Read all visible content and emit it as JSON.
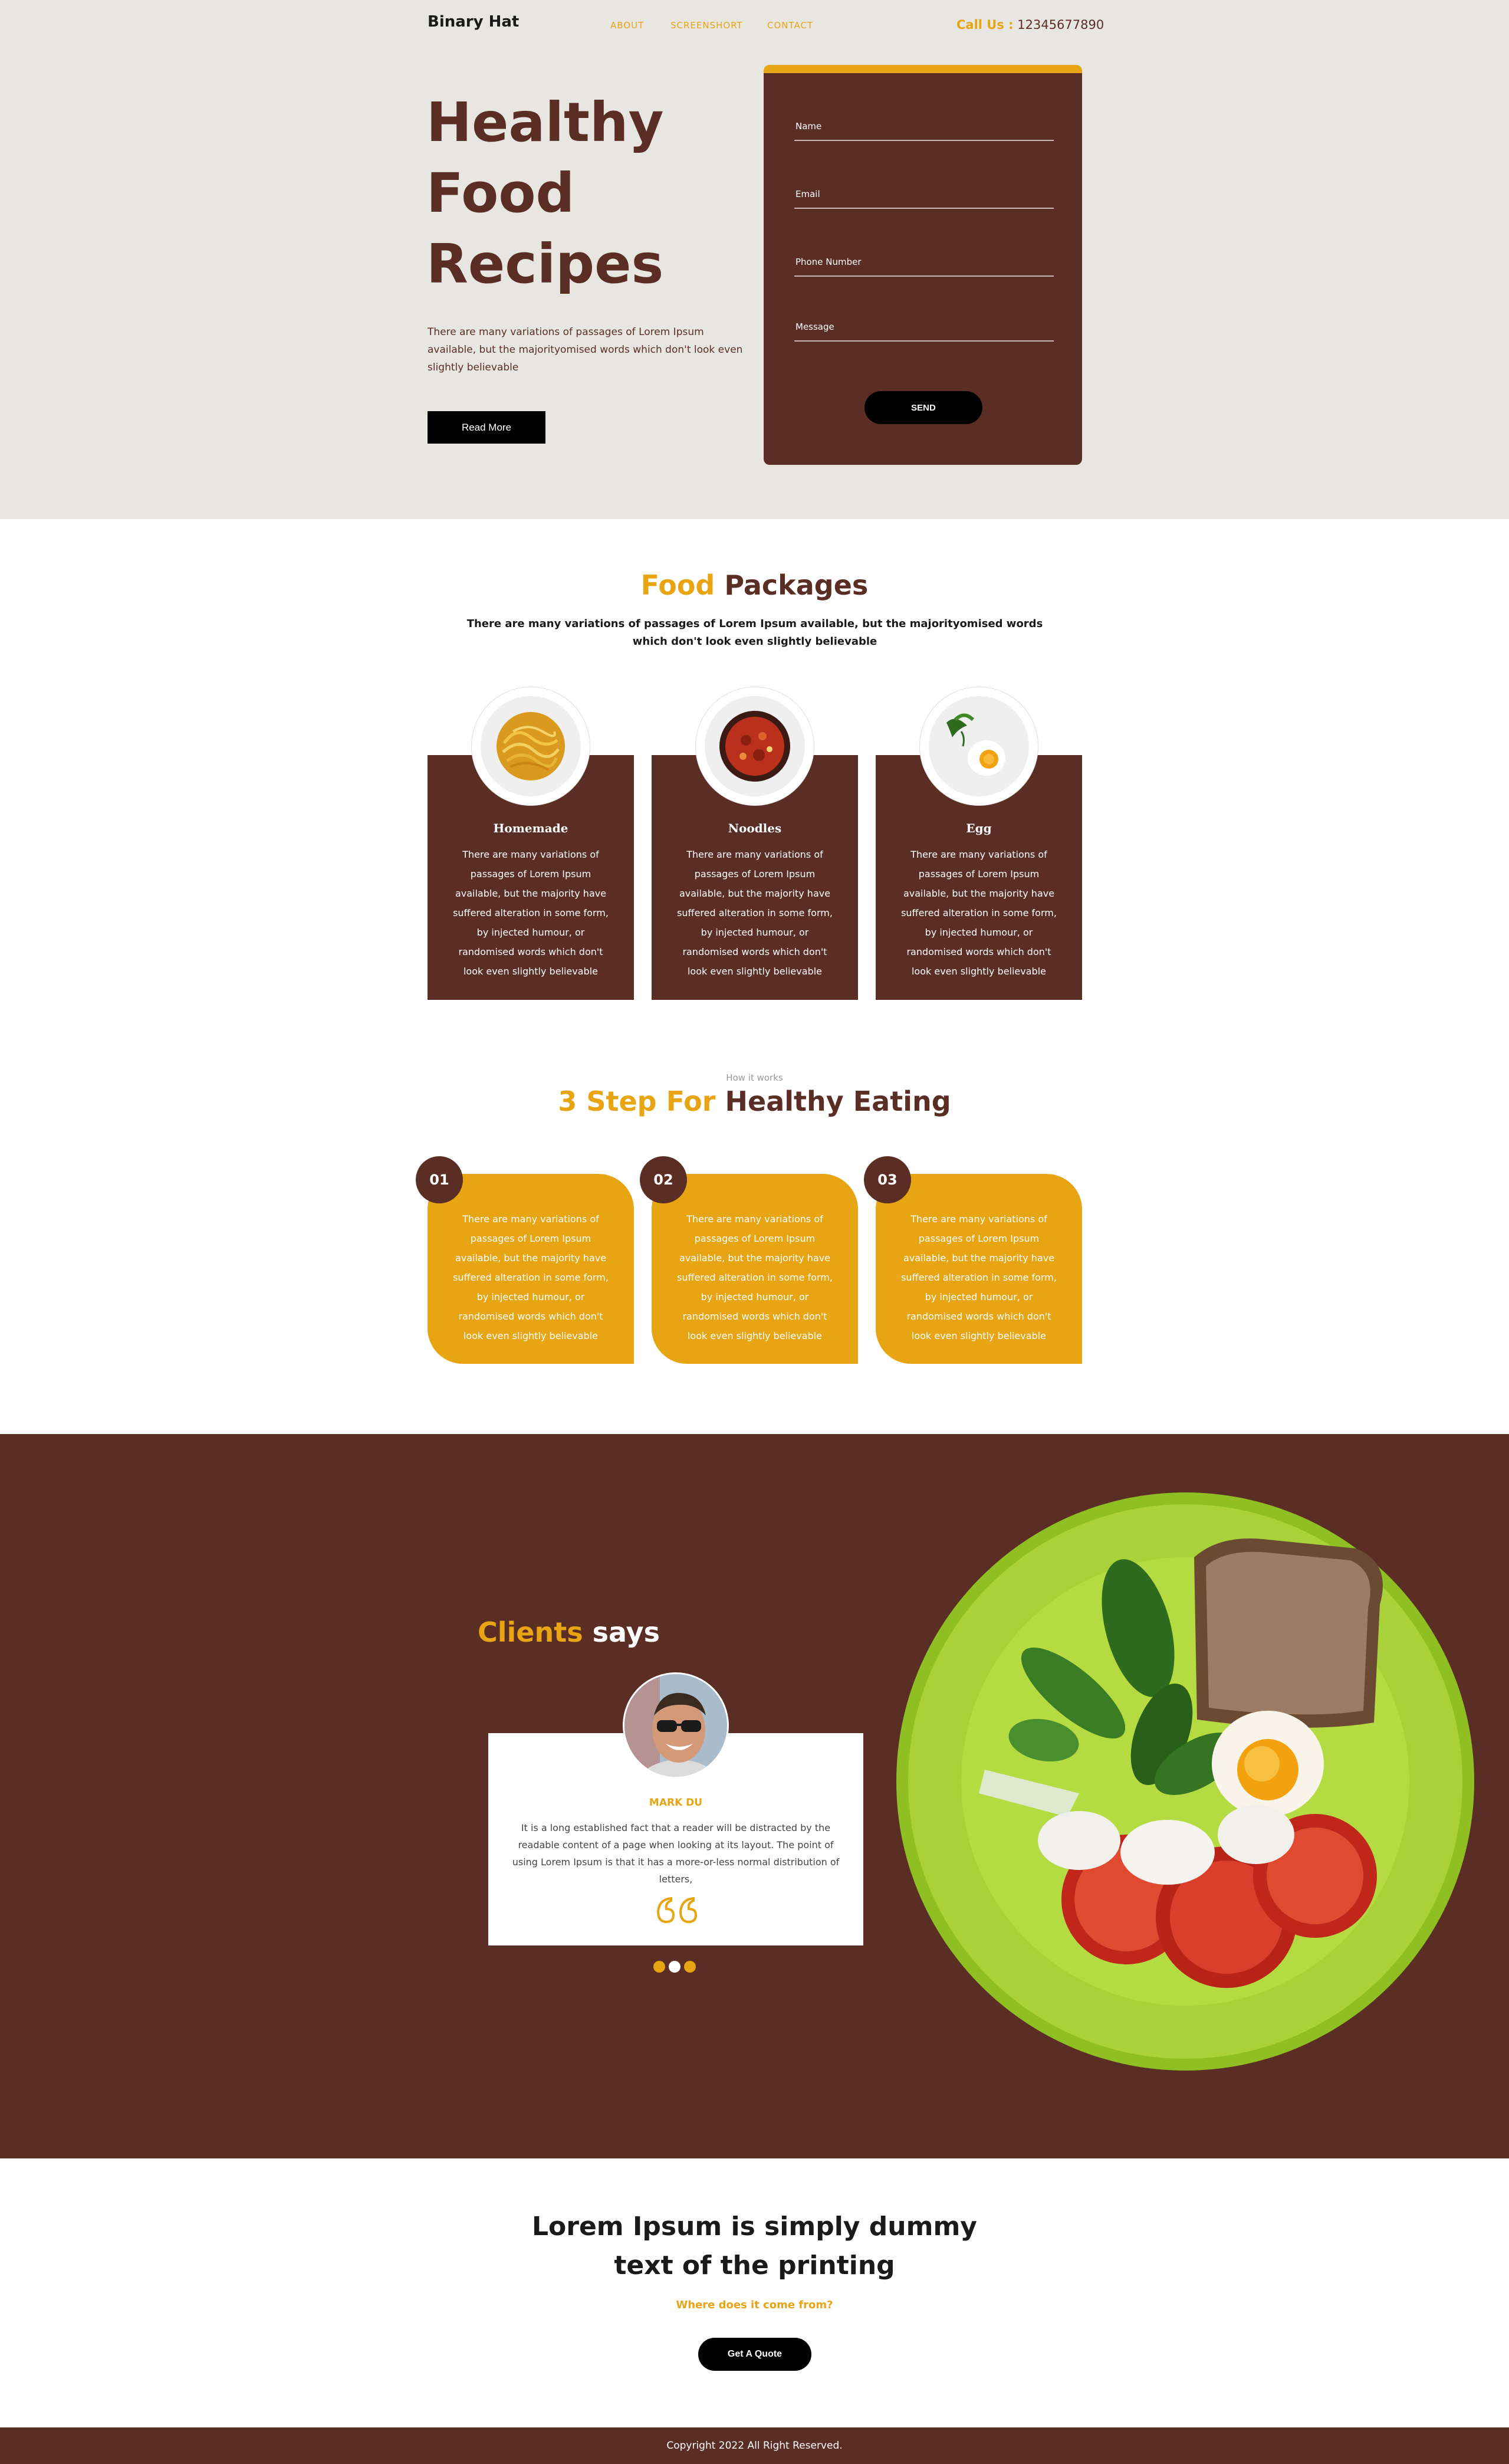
{
  "header": {
    "logo": "Binary Hat",
    "nav": [
      "ABOUT",
      "SCREENSHORT",
      "CONTACT"
    ],
    "call_label": "Call Us :",
    "call_number": "12345677890"
  },
  "hero": {
    "title_lines": [
      "Healthy",
      "Food",
      "Recipes"
    ],
    "description": "There are many variations of passages of Lorem Ipsum available, but the majorityomised words which don't look even slightly believable",
    "read_more": "Read More"
  },
  "form": {
    "fields": [
      "Name",
      "Email",
      "Phone Number",
      "Message"
    ],
    "send": "SEND"
  },
  "packages": {
    "title_accent": "Food",
    "title_rest": "Packages",
    "subtitle": "There are many variations of passages of Lorem Ipsum available, but the majorityomised words which don't look even slightly believable",
    "items": [
      {
        "name": "Homemade",
        "text": "There are many variations of passages of Lorem Ipsum available, but the majority have suffered alteration in some form, by injected humour, or randomised words which don't look even slightly believable"
      },
      {
        "name": "Noodles",
        "text": "There are many variations of passages of Lorem Ipsum available, but the majority have suffered alteration in some form, by injected humour, or randomised words which don't look even slightly believable"
      },
      {
        "name": "Egg",
        "text": "There are many variations of passages of Lorem Ipsum available, but the majority have suffered alteration in some form, by injected humour, or randomised words which don't look even slightly believable"
      }
    ]
  },
  "steps": {
    "kicker": "How it works",
    "title_accent": "3 Step For",
    "title_rest": "Healthy Eating",
    "items": [
      {
        "num": "01",
        "text": "There are many variations of passages of Lorem Ipsum available, but the majority have suffered alteration in some form, by injected humour, or randomised words which don't look even slightly believable"
      },
      {
        "num": "02",
        "text": "There are many variations of passages of Lorem Ipsum available, but the majority have suffered alteration in some form, by injected humour, or randomised words which don't look even slightly believable"
      },
      {
        "num": "03",
        "text": "There are many variations of passages of Lorem Ipsum available, but the majority have suffered alteration in some form, by injected humour, or randomised words which don't look even slightly believable"
      }
    ]
  },
  "clients": {
    "title_accent": "Clients",
    "title_rest": "says",
    "name": "MARK DU",
    "text": "It is a long established fact that a reader will be distracted by the readable content of a page when looking at its layout. The point of using Lorem Ipsum is that it has a more-or-less normal distribution of letters,",
    "active_dot": 1
  },
  "cta": {
    "title_line1": "Lorem Ipsum is simply dummy",
    "title_line2": "text of the printing",
    "subtitle": "Where does it come from?",
    "button": "Get A Quote"
  },
  "footer": {
    "copyright": "Copyright 2022 All Right Reserved."
  },
  "colors": {
    "brown": "#5b2e25",
    "orange": "#e7a413",
    "hero_bg": "#e8e6e1",
    "plate_green": "#a9d23a"
  }
}
